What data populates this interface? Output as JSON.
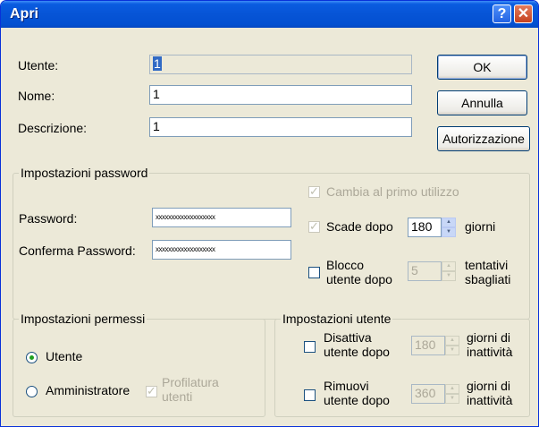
{
  "window": {
    "title": "Apri"
  },
  "fields": {
    "utente_label": "Utente:",
    "utente_value": "1",
    "nome_label": "Nome:",
    "nome_value": "1",
    "descrizione_label": "Descrizione:",
    "descrizione_value": "1"
  },
  "buttons": {
    "ok": "OK",
    "annulla": "Annulla",
    "autorizzazione": "Autorizzazione"
  },
  "password_group": {
    "title": "Impostazioni password",
    "cambia_label": "Cambia al primo utilizzo",
    "password_label": "Password:",
    "password_value": "xxxxxxxxxxxxxxxxxxx",
    "conferma_label": "Conferma Password:",
    "conferma_value": "xxxxxxxxxxxxxxxxxxx",
    "scade_label": "Scade dopo",
    "scade_value": "180",
    "giorni_label": "giorni",
    "blocco_label_1": "Blocco",
    "blocco_label_2": "utente dopo",
    "blocco_value": "5",
    "tentativi_label_1": "tentativi",
    "tentativi_label_2": "sbagliati"
  },
  "permessi_group": {
    "title": "Impostazioni permessi",
    "utente_label": "Utente",
    "amministratore_label": "Amministratore",
    "profilatura_label_1": "Profilatura",
    "profilatura_label_2": "utenti"
  },
  "utente_group": {
    "title": "Impostazioni utente",
    "disattiva_label_1": "Disattiva",
    "disattiva_label_2": "utente dopo",
    "disattiva_value": "180",
    "disattiva_suffix_1": "giorni di",
    "disattiva_suffix_2": "inattività",
    "rimuovi_label_1": "Rimuovi",
    "rimuovi_label_2": "utente dopo",
    "rimuovi_value": "360",
    "rimuovi_suffix_1": "giorni di",
    "rimuovi_suffix_2": "inattività"
  },
  "colors": {
    "titlebar": "#0654d6",
    "dialog_bg": "#ece9d8",
    "selection": "#316ac5"
  }
}
